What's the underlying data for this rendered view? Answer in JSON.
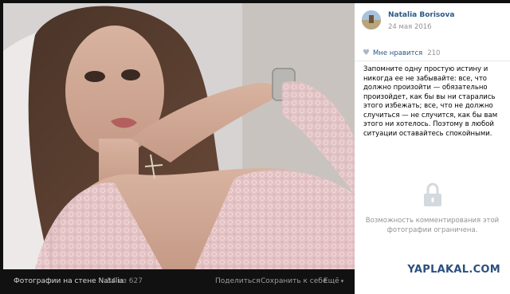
{
  "author": {
    "name": "Natalia Borisova",
    "date": "24 мая 2016"
  },
  "likes": {
    "label": "Мне нравится",
    "count": "210",
    "icon": "heart-icon"
  },
  "post_text": "Запомните одну простую истину и никогда ее не забывайте: все, что должно произойти — обязательно произойдет, как бы вы ни старались этого избежать; все, что не должно случиться — не случится, как бы вам этого ни хотелось. Поэтому в любой ситуации оставайтесь спокойными.",
  "comments_restricted": {
    "icon": "lock-icon",
    "text": "Возможность комментирования этой фотографии ограничена."
  },
  "bottom_bar": {
    "caption": "Фотографии на стене Natalia",
    "counter": "34 из 627",
    "share": "Поделиться",
    "save": "Сохранить к себе",
    "more": "Ещё"
  },
  "watermark": "YAPLAKAL.COM",
  "colors": {
    "link": "#2a5885",
    "muted": "#939393",
    "viewer_bg": "#0f0f10"
  }
}
